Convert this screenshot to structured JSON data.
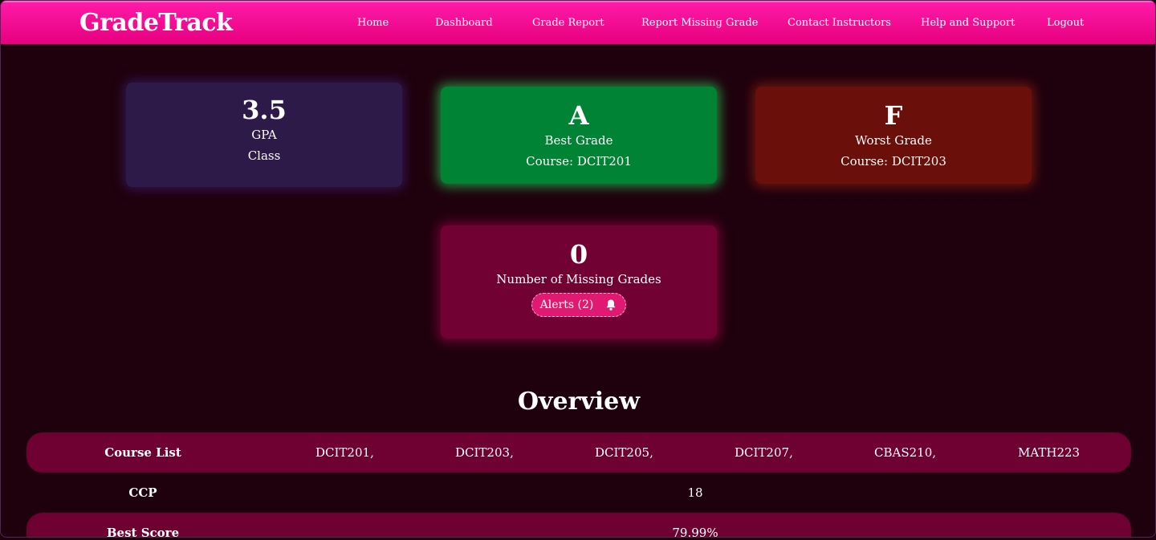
{
  "app": {
    "title": "GradeTrack"
  },
  "nav": {
    "items": [
      {
        "label": "Home"
      },
      {
        "label": "Dashboard"
      },
      {
        "label": "Grade Report"
      },
      {
        "label": "Report Missing Grade"
      },
      {
        "label": "Contact Instructors"
      },
      {
        "label": "Help and Support"
      },
      {
        "label": "Logout"
      }
    ]
  },
  "cards": {
    "gpa": {
      "value": "3.5",
      "label": "GPA",
      "sub": "Class"
    },
    "best": {
      "value": "A",
      "label": "Best Grade",
      "sub": "Course: DCIT201"
    },
    "worst": {
      "value": "F",
      "label": "Worst Grade",
      "sub": "Course: DCIT203"
    },
    "missing": {
      "value": "0",
      "label": "Number of Missing Grades",
      "alerts_label": "Alerts (2)",
      "alerts_icon": "bell-icon"
    }
  },
  "overview": {
    "title": "Overview",
    "course_list": {
      "label": "Course List",
      "courses": [
        "DCIT201,",
        "DCIT203,",
        "DCIT205,",
        "DCIT207,",
        "CBAS210,",
        "MATH223"
      ]
    },
    "ccp": {
      "label": "CCP",
      "value": "18"
    },
    "best_score": {
      "label": "Best Score",
      "value": "79.99%"
    }
  },
  "colors": {
    "navbar": "#e6007e",
    "background": "#1f000d",
    "gpa_card": "#2d1a48",
    "best_card": "#008334",
    "worst_card": "#6b0f0a",
    "missing_card": "#710033",
    "row_fill": "#6e0032"
  }
}
